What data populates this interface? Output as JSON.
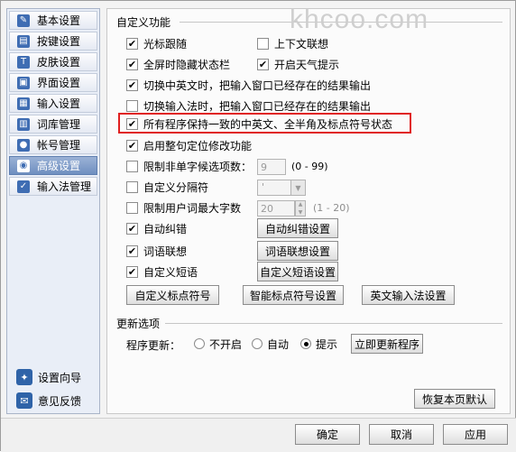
{
  "watermark": "khcoo.com",
  "sidebar": {
    "items": [
      {
        "label": "基本设置",
        "icon": "wrench-icon",
        "glyph": "✎"
      },
      {
        "label": "按键设置",
        "icon": "keyboard-icon",
        "glyph": "▤"
      },
      {
        "label": "皮肤设置",
        "icon": "shirt-icon",
        "glyph": "T"
      },
      {
        "label": "界面设置",
        "icon": "window-icon",
        "glyph": "▣"
      },
      {
        "label": "输入设置",
        "icon": "input-icon",
        "glyph": "▦"
      },
      {
        "label": "词库管理",
        "icon": "book-icon",
        "glyph": "▥"
      },
      {
        "label": "帐号管理",
        "icon": "user-icon",
        "glyph": "●"
      },
      {
        "label": "高级设置",
        "icon": "advanced-icon",
        "glyph": "◉"
      },
      {
        "label": "输入法管理",
        "icon": "checklist-icon",
        "glyph": "✓"
      }
    ],
    "bottom": [
      {
        "label": "设置向导",
        "icon": "wizard-icon",
        "glyph": "✦"
      },
      {
        "label": "意见反馈",
        "icon": "feedback-icon",
        "glyph": "✉"
      }
    ]
  },
  "custom": {
    "title": "自定义功能",
    "cursor_follow": "光标跟随",
    "context_assoc": "上下文联想",
    "fullscreen_hide": "全屏时隐藏状态栏",
    "weather": "开启天气提示",
    "switch_cn_en": "切换中英文时，把输入窗口已经存在的结果输出",
    "switch_ime": "切换输入法时，把输入窗口已经存在的结果输出",
    "consistent_state": "所有程序保持一致的中英文、全半角及标点符号状态",
    "sentence_locate": "启用整句定位修改功能",
    "limit_single": "限制非单字候选项数：",
    "limit_single_value": "9",
    "limit_single_range": "(0 - 99)",
    "custom_sep": "自定义分隔符",
    "custom_sep_value": "'",
    "limit_user_word": "限制用户词最大字数",
    "limit_user_word_value": "20",
    "limit_user_word_range": "(1 - 20)",
    "auto_correct": "自动纠错",
    "auto_correct_btn": "自动纠错设置",
    "word_assoc": "词语联想",
    "word_assoc_btn": "词语联想设置",
    "custom_phrase": "自定义短语",
    "custom_phrase_btn": "自定义短语设置",
    "custom_punct_btn": "自定义标点符号",
    "smart_punct_btn": "智能标点符号设置",
    "en_ime_btn": "英文输入法设置"
  },
  "update": {
    "title": "更新选项",
    "label": "程序更新：",
    "opt_off": "不开启",
    "opt_auto": "自动",
    "opt_prompt": "提示",
    "selected": "提示",
    "update_now_btn": "立即更新程序"
  },
  "restore_btn": "恢复本页默认",
  "footer": {
    "ok": "确定",
    "cancel": "取消",
    "apply": "应用"
  }
}
